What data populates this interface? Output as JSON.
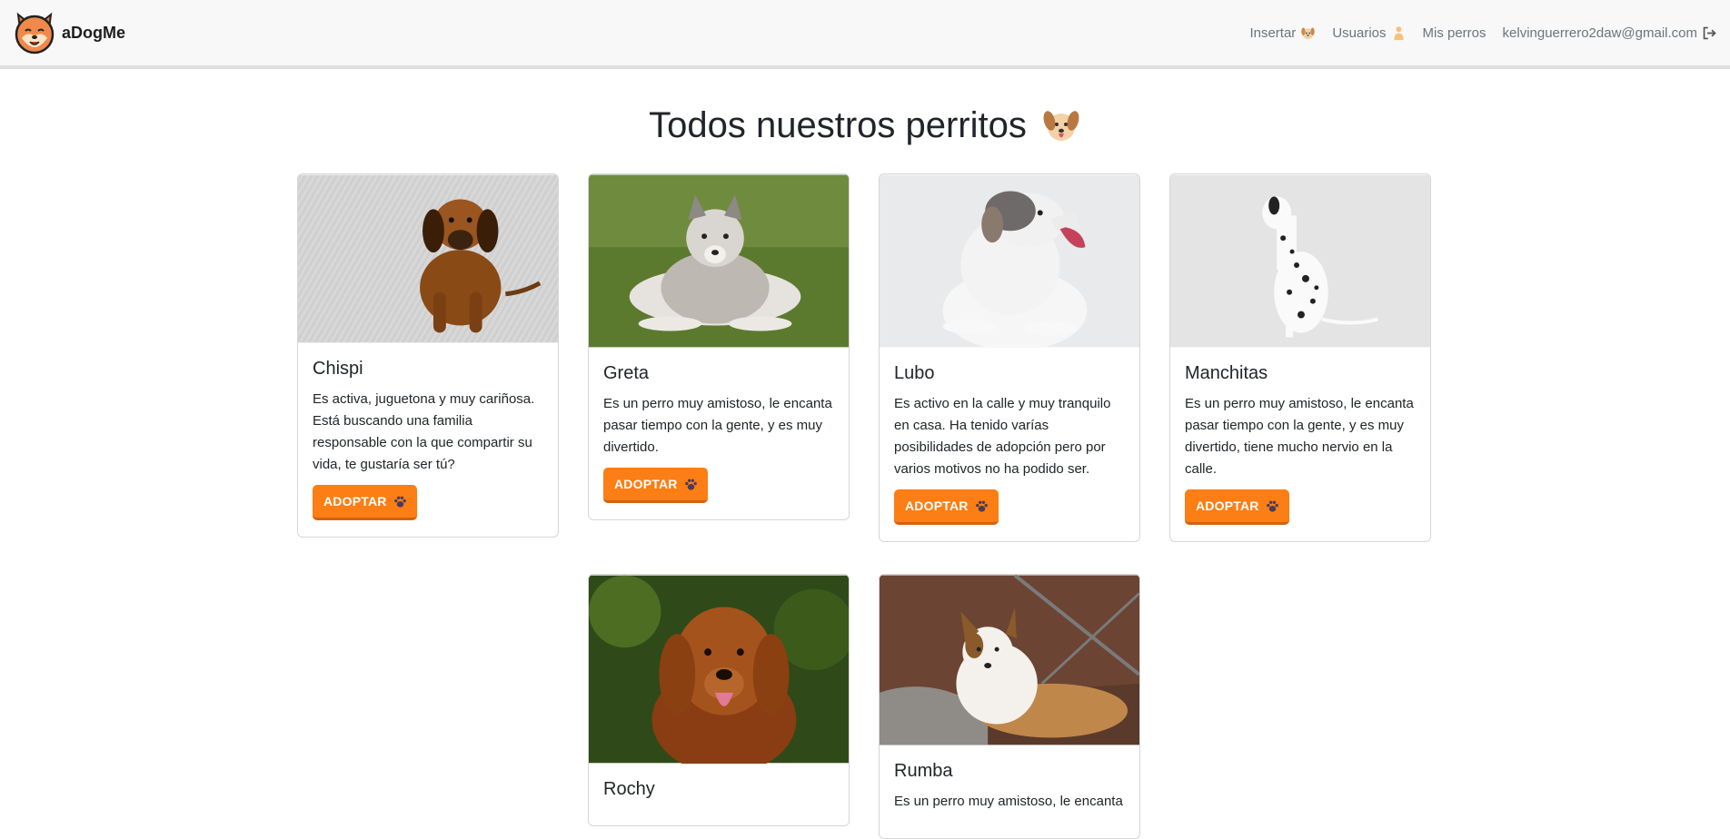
{
  "brand": {
    "name": "aDogMe",
    "logo_icon": "shiba-dog-logo-icon"
  },
  "nav": {
    "items": [
      {
        "label": "Insertar",
        "icon": "dog-face-icon"
      },
      {
        "label": "Usuarios",
        "icon": "person-icon"
      },
      {
        "label": "Mis perros"
      },
      {
        "label": "kelvinguerrero2daw@gmail.com",
        "icon": "logout-icon"
      }
    ]
  },
  "main": {
    "title": "Todos nuestros perritos",
    "title_icon": "dog-face-icon"
  },
  "adopt_label": "ADOPTAR",
  "colors": {
    "accent": "#fd7e14",
    "navbar_bg": "#f8f8f8"
  },
  "dogs": [
    {
      "name": "Chispi",
      "description": "Es activa, juguetona y muy cariñosa. Está buscando una familia responsable con la que compartir su vida, te gustaría ser tú?"
    },
    {
      "name": "Greta",
      "description": "Es un perro muy amistoso, le encanta pasar tiempo con la gente, y es muy divertido."
    },
    {
      "name": "Lubo",
      "description": "Es activo en la calle y muy tranquilo en casa. Ha tenido varías posibilidades de adopción pero por varios motivos no ha podido ser."
    },
    {
      "name": "Manchitas",
      "description": "Es un perro muy amistoso, le encanta pasar tiempo con la gente, y es muy divertido, tiene mucho nervio en la calle."
    },
    {
      "name": "Rochy",
      "description": ""
    },
    {
      "name": "Rumba",
      "description": "Es un perro muy amistoso, le encanta"
    }
  ]
}
